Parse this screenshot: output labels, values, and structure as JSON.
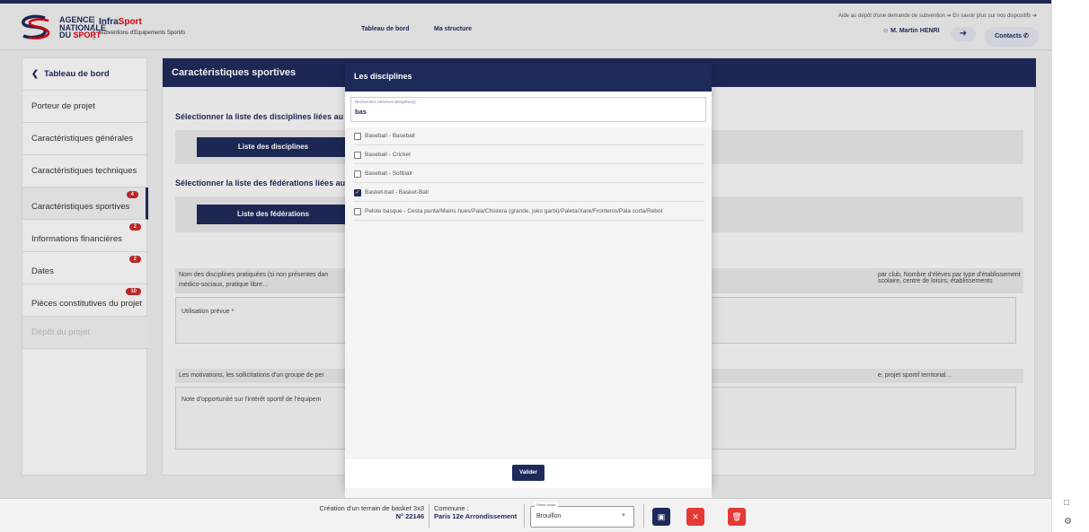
{
  "header": {
    "agency_line1": "AGENCE",
    "agency_line2": "NATIONALE",
    "agency_line3_a": "DU",
    "agency_line3_b": "SPORT",
    "brand_a": "Infra",
    "brand_b": "Sport",
    "brand_sub": "Subventions d'Equipements Sportifs",
    "nav_dashboard": "Tableau de bord",
    "nav_structure": "Ma structure",
    "help_text": "Aide au dépôt d'une demande de subvention ➔  En savoir plus sur nos dispositifs ➔",
    "user_name": "M. Martin HENRI",
    "contacts_label": "Contacts"
  },
  "sidebar": {
    "back_label": "Tableau de bord",
    "items": [
      {
        "label": "Porteur de projet",
        "badge": ""
      },
      {
        "label": "Caractéristiques générales",
        "badge": ""
      },
      {
        "label": "Caractéristiques techniques",
        "badge": ""
      },
      {
        "label": "Caractéristiques sportives",
        "badge": "4"
      },
      {
        "label": "Informations financières",
        "badge": "2"
      },
      {
        "label": "Dates",
        "badge": "2"
      },
      {
        "label": "Pièces constitutives du projet",
        "badge": "10"
      },
      {
        "label": "Dépôt du projet",
        "badge": ""
      }
    ]
  },
  "main": {
    "title": "Caractéristiques sportives",
    "disciplines_label": "Sélectionner la liste des disciplines liées au p",
    "disciplines_button": "Liste des disciplines",
    "federations_label": "Sélectionner la liste des fédérations liées au",
    "federations_button": "Liste des fédérations",
    "practices_text_left": "Nom des disciplines pratiquées (si non présentes dan",
    "practices_text_left2": "médico-sociaux, pratique libre…",
    "practices_text_right": "par club, Nombre d'élèves par type d'établissement scolaire, centre de loisirs, établissements",
    "usage_label": "Utilisation prévue *",
    "motivations_left": "Les motivations, les sollicitations d'un groupe de per",
    "motivations_right": "e, projet sportif territorial…",
    "opportunity_placeholder": "Note d'opportunité sur l'intérêt sportif de l'équipem"
  },
  "modal": {
    "title": "Les disciplines",
    "search_placeholder": "Rechercher votre/vos discipline(s)",
    "search_value": "bas",
    "items": [
      {
        "label": "Baseball - Baseball",
        "checked": false
      },
      {
        "label": "Baseball - Cricket",
        "checked": false
      },
      {
        "label": "Baseball - Softball",
        "checked": false
      },
      {
        "label": "Basket-ball - Basket-Ball",
        "checked": true
      },
      {
        "label": "Pelote basque - Cesta punta/Mains nues/Pala/Chistera (grande, joko garbi)/Paleta/Xare/Frontenis/Pala corta/Rebot",
        "checked": false
      }
    ],
    "validate_label": "Valider"
  },
  "footer": {
    "project_name": "Création d'un terrain de basket 3x3",
    "project_number": "N° 22146",
    "commune_label": "Commune :",
    "commune_value": "Paris 12e Arrondissement",
    "status_label": "Statut projet",
    "status_value": "Brouillon"
  },
  "colors": {
    "primary": "#1e2a5a",
    "danger": "#e53935",
    "badge": "#c62828"
  }
}
